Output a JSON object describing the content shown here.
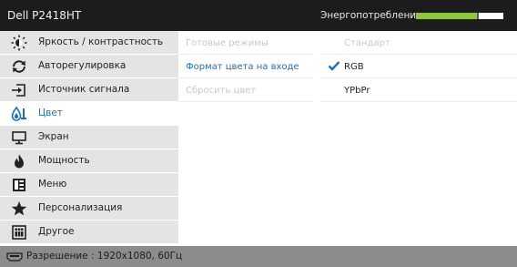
{
  "header": {
    "model": "Dell P2418HT",
    "energy_label": "Энергопотребление",
    "energy_level": 0.7,
    "energy_color": "#8dc63f"
  },
  "sidebar": {
    "items": [
      {
        "label": "Яркость / контрастность",
        "icon": "brightness-icon"
      },
      {
        "label": "Авторегулировка",
        "icon": "auto-adjust-icon"
      },
      {
        "label": "Источник сигнала",
        "icon": "input-source-icon"
      },
      {
        "label": "Цвет",
        "icon": "color-icon",
        "active": true
      },
      {
        "label": "Экран",
        "icon": "display-icon"
      },
      {
        "label": "Мощность",
        "icon": "power-icon"
      },
      {
        "label": "Меню",
        "icon": "menu-icon"
      },
      {
        "label": "Персонализация",
        "icon": "star-icon"
      },
      {
        "label": "Другое",
        "icon": "other-icon"
      }
    ]
  },
  "content": {
    "rows": [
      {
        "label": "Готовые режимы",
        "value": "Стандарт",
        "enabled": false
      },
      {
        "label": "Формат цвета на входе",
        "value": "RGB",
        "selected": true
      },
      {
        "label": "Сбросить цвет",
        "value": "YPbPr",
        "enabled": false
      }
    ]
  },
  "status": {
    "resolution": "Разрешение : 1920x1080, 60Гц",
    "icon": "hdmi-icon"
  },
  "colors": {
    "accent": "#1f6fb5",
    "topbar": "#1c1c1c",
    "menu_bg": "#e4e4e4",
    "status_bg": "#8c8c8c"
  }
}
